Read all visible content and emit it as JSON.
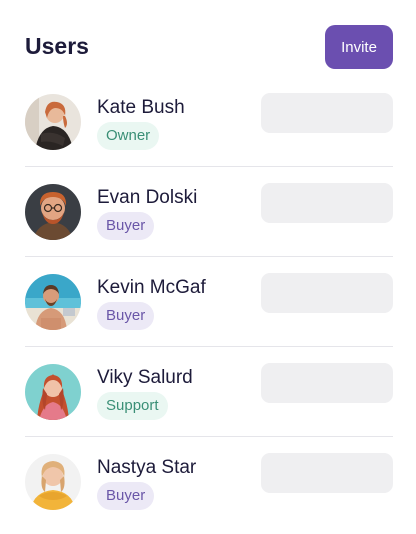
{
  "header": {
    "title": "Users",
    "invite_label": "Invite",
    "accent_color": "#6b4fb0"
  },
  "users": [
    {
      "name": "Kate Bush",
      "role": "Owner"
    },
    {
      "name": "Evan Dolski",
      "role": "Buyer"
    },
    {
      "name": "Kevin McGaf",
      "role": "Buyer"
    },
    {
      "name": "Viky Salurd",
      "role": "Support"
    },
    {
      "name": "Nastya Star",
      "role": "Buyer"
    }
  ],
  "colors": {
    "owner_badge_bg": "#eaf7f2",
    "owner_badge_text": "#3a8f76",
    "buyer_badge_bg": "#ece9f6",
    "buyer_badge_text": "#6a56a8",
    "placeholder": "#efeff1"
  }
}
